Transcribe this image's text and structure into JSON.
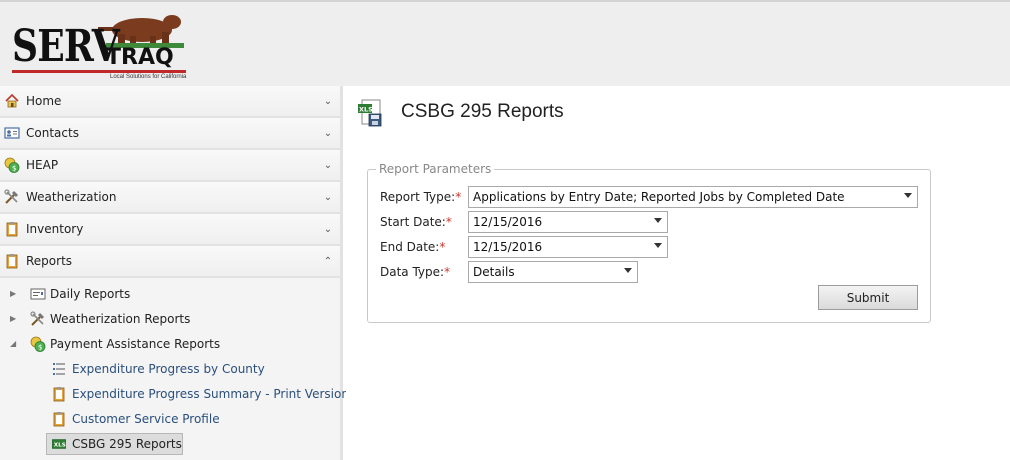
{
  "brand": {
    "name_left": "SERV",
    "name_right": "TRAQ",
    "tagline": "Local Solutions for California"
  },
  "sidebar": {
    "menu": [
      {
        "label": "Home",
        "icon": "house-icon",
        "expanded": false
      },
      {
        "label": "Contacts",
        "icon": "contact-card-icon",
        "expanded": false
      },
      {
        "label": "HEAP",
        "icon": "coins-icon",
        "expanded": false
      },
      {
        "label": "Weatherization",
        "icon": "tools-icon",
        "expanded": false
      },
      {
        "label": "Inventory",
        "icon": "clipboard-icon",
        "expanded": false
      },
      {
        "label": "Reports",
        "icon": "clipboard-icon",
        "expanded": true
      }
    ],
    "reports_children": [
      {
        "label": "Daily Reports",
        "icon": "report-icon",
        "expanded": false
      },
      {
        "label": "Weatherization Reports",
        "icon": "tools-icon",
        "expanded": false
      },
      {
        "label": "Payment Assistance Reports",
        "icon": "coins-icon",
        "expanded": true
      }
    ],
    "payment_reports": [
      {
        "label": "Expenditure Progress by County",
        "icon": "list-icon"
      },
      {
        "label": "Expenditure Progress Summary - Print Version",
        "icon": "clipboard-icon"
      },
      {
        "label": "Customer Service Profile",
        "icon": "clipboard-icon"
      },
      {
        "label": "CSBG 295 Reports",
        "icon": "xls-icon",
        "selected": true
      }
    ]
  },
  "main": {
    "title": "CSBG 295 Reports",
    "fieldset_legend": "Report Parameters",
    "required_mark": "*",
    "fields": {
      "report_type": {
        "label": "Report Type:",
        "value": "Applications by Entry Date; Reported Jobs by Completed Date"
      },
      "start_date": {
        "label": "Start Date:",
        "value": "12/15/2016"
      },
      "end_date": {
        "label": "End Date:",
        "value": "12/15/2016"
      },
      "data_type": {
        "label": "Data Type:",
        "value": "Details"
      }
    },
    "submit_label": "Submit"
  },
  "colors": {
    "header_bg": "#eeeeee",
    "logo_red": "#c0282a",
    "link_blue": "#2a4f7c",
    "required_red": "#d0342c"
  }
}
